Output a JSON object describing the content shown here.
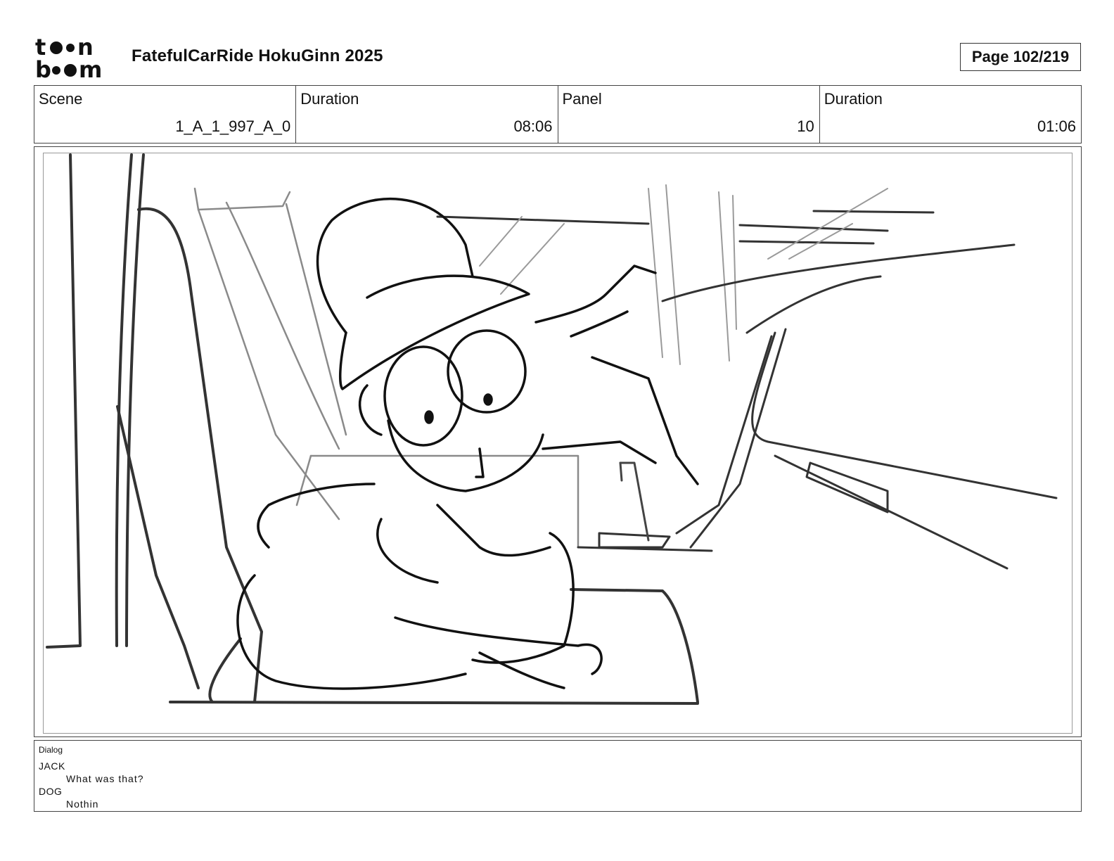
{
  "header": {
    "logo_text": "toon boom",
    "project_title": "FatefulCarRide HokuGinn 2025",
    "page_label": "Page 102/219"
  },
  "info": {
    "scene_label": "Scene",
    "scene_value": "1_A_1_997_A_0",
    "scene_duration_label": "Duration",
    "scene_duration_value": "08:06",
    "panel_label": "Panel",
    "panel_value": "10",
    "panel_duration_label": "Duration",
    "panel_duration_value": "01:06"
  },
  "dialog": {
    "heading": "Dialog",
    "entries": [
      {
        "speaker": "JACK",
        "line": "What was that?"
      },
      {
        "speaker": "DOG",
        "line": "Nothin"
      }
    ]
  },
  "colors": {
    "ink": "#111111",
    "border": "#444444",
    "sketch_line": "#222222",
    "sketch_light": "#8a8a8a"
  }
}
